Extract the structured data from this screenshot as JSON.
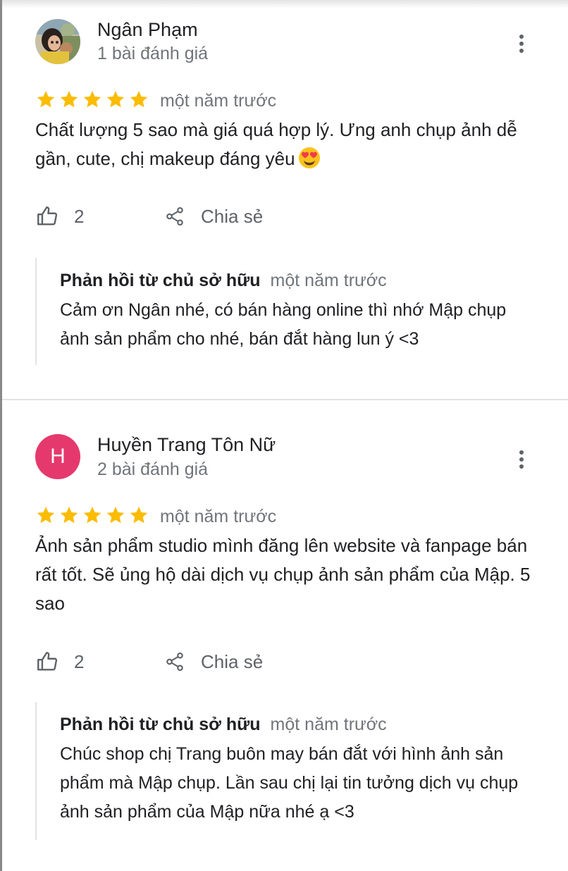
{
  "colors": {
    "star": "#fbbc04",
    "secondary_text": "#70757a",
    "primary_text": "#202124",
    "avatar_h": "#e5396d"
  },
  "reviews": [
    {
      "author": "Ngân Phạm",
      "meta": "1 bài đánh giá",
      "avatar": "photo",
      "rating": 5,
      "date": "một năm trước",
      "text": "Chất lượng 5 sao mà giá quá hợp lý. Ưng anh chụp ảnh dễ gần, cute, chị makeup đáng yêu",
      "emoji": "smiling-face-with-heart-eyes",
      "likes": "2",
      "share_label": "Chia sẻ",
      "reply": {
        "owner_label": "Phản hồi từ chủ sở hữu",
        "date": "một năm trước",
        "text": "Cảm ơn Ngân nhé, có bán hàng online thì nhớ Mập chụp ảnh sản phẩm cho nhé, bán đắt hàng lun ý <3"
      }
    },
    {
      "author": "Huyền Trang Tôn Nữ",
      "meta": "2 bài đánh giá",
      "avatar_letter": "H",
      "rating": 5,
      "date": "một năm trước",
      "text": "Ảnh sản phẩm studio mình đăng lên website và fanpage bán rất tốt. Sẽ ủng hộ dài dịch vụ chụp ảnh sản phẩm của Mập. 5 sao",
      "likes": "2",
      "share_label": "Chia sẻ",
      "reply": {
        "owner_label": "Phản hồi từ chủ sở hữu",
        "date": "một năm trước",
        "text": "Chúc shop chị Trang buôn may bán đắt với hình ảnh sản phẩm mà Mập chụp. Lần sau chị lại tin tưởng dịch vụ chụp ảnh sản phẩm của Mập nữa nhé ạ <3"
      }
    }
  ]
}
